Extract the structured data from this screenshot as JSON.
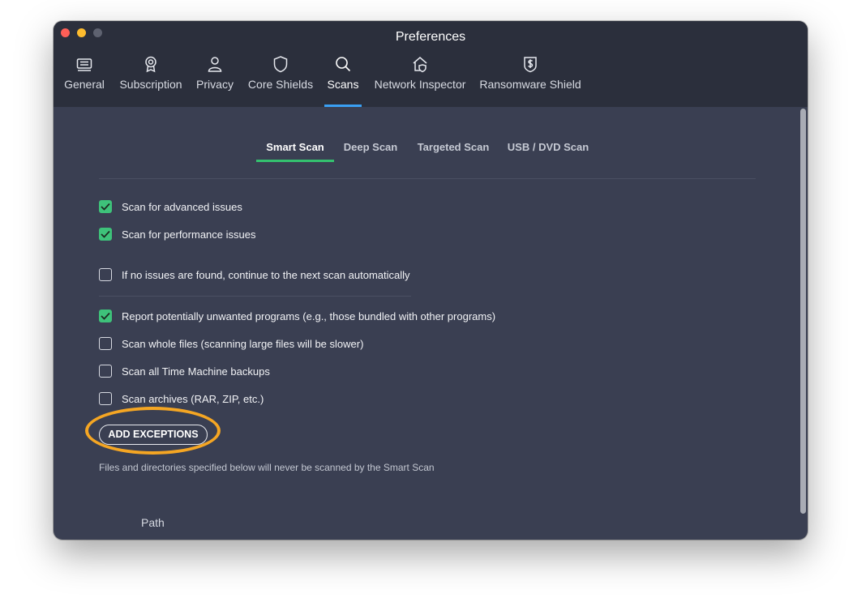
{
  "window": {
    "title": "Preferences"
  },
  "nav": [
    {
      "id": "general",
      "label": "General",
      "icon": "keyboard-icon"
    },
    {
      "id": "subscription",
      "label": "Subscription",
      "icon": "badge-icon"
    },
    {
      "id": "privacy",
      "label": "Privacy",
      "icon": "person-icon"
    },
    {
      "id": "core-shields",
      "label": "Core Shields",
      "icon": "shield-icon"
    },
    {
      "id": "scans",
      "label": "Scans",
      "icon": "search-icon",
      "active": true
    },
    {
      "id": "network-inspector",
      "label": "Network Inspector",
      "icon": "home-shield-icon"
    },
    {
      "id": "ransomware-shield",
      "label": "Ransomware Shield",
      "icon": "dollar-shield-icon"
    }
  ],
  "subtabs": [
    {
      "label": "Smart Scan",
      "active": true
    },
    {
      "label": "Deep Scan"
    },
    {
      "label": "Targeted Scan"
    },
    {
      "label": "USB / DVD Scan"
    }
  ],
  "options": [
    {
      "label": "Scan for advanced issues",
      "checked": true
    },
    {
      "label": "Scan for performance issues",
      "checked": true
    },
    {
      "label": "If no issues are found, continue to the next scan automatically",
      "checked": false
    },
    {
      "label": "Report potentially unwanted programs (e.g., those bundled with other programs)",
      "checked": true
    },
    {
      "label": "Scan whole files (scanning large files will be slower)",
      "checked": false
    },
    {
      "label": "Scan all Time Machine backups",
      "checked": false
    },
    {
      "label": "Scan archives (RAR, ZIP, etc.)",
      "checked": false
    }
  ],
  "exceptions": {
    "button_label": "ADD EXCEPTIONS",
    "hint": "Files and directories specified below will never be scanned by the Smart Scan",
    "column_path": "Path"
  },
  "colors": {
    "accent_blue": "#3aa0f4",
    "accent_green": "#34c16f",
    "highlight_orange": "#f5a623",
    "background": "#3a3f52",
    "titlebar": "#2b2f3c"
  }
}
